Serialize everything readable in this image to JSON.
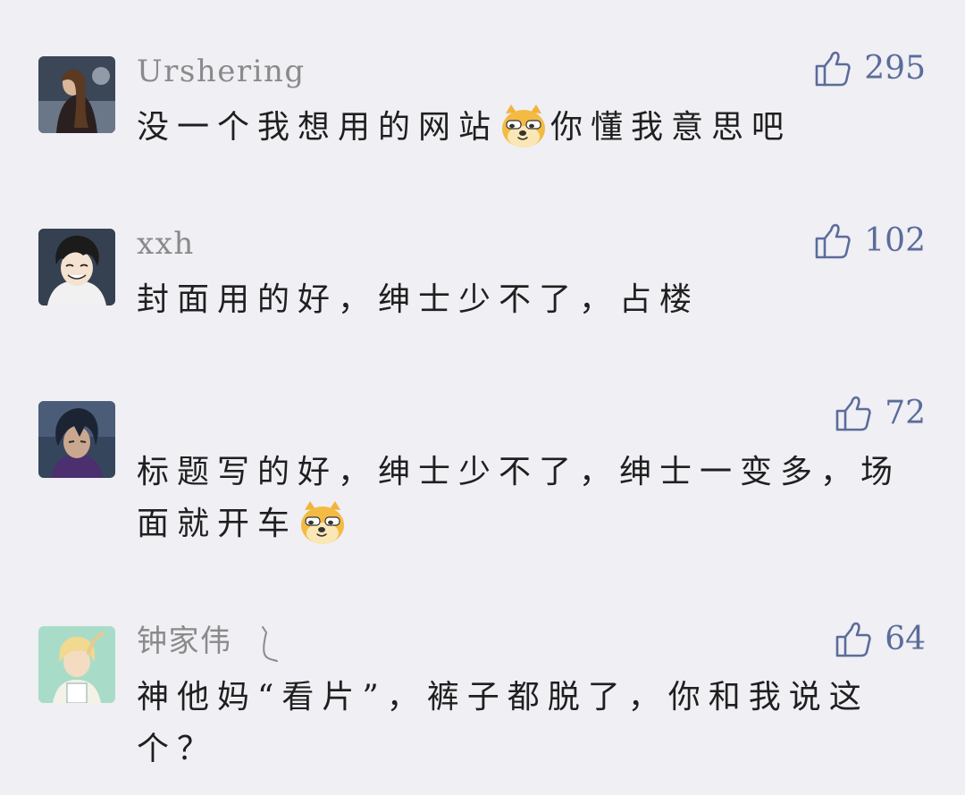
{
  "comments": [
    {
      "username": "Urshering",
      "likes": "295",
      "text_before_emoji": "没一个我想用的网站",
      "emoji": "doge-icon",
      "text_after_emoji": "你懂我意思吧"
    },
    {
      "username": "xxh",
      "likes": "102",
      "text_line1": "封面用的好，绅士少不了，占楼"
    },
    {
      "username": "",
      "likes": "72",
      "text_line1": "标题写的好，绅士少不了，绅士一变多，场",
      "text_line2": "面就开车",
      "emoji": "doge-icon"
    },
    {
      "username": "钟家伟",
      "likes": "64",
      "text_line1": "神他妈“看片”，裤子都脱了，你和我说这",
      "text_line2": "个？"
    }
  ],
  "colors": {
    "background": "#efeff4",
    "username": "#8a8a8a",
    "like_accent": "#5b6c9a",
    "body_text": "#1f1f1f"
  }
}
